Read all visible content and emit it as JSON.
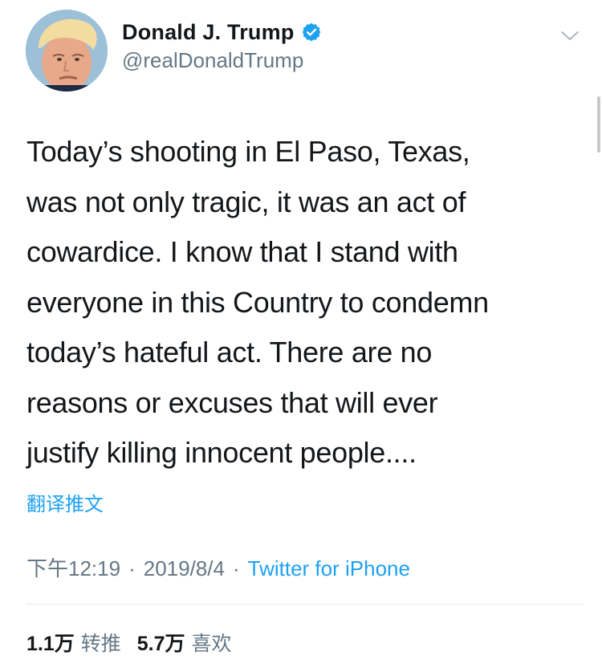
{
  "author": {
    "display_name": "Donald J. Trump",
    "handle": "@realDonaldTrump",
    "avatar_icon": "profile-photo",
    "verified_icon": "verified-badge-icon"
  },
  "menu_icon": "chevron-down-icon",
  "tweet": {
    "lines": [
      "Today’s shooting in El Paso, Texas,",
      "was not only tragic, it was an act of",
      "cowardice. I know that I stand with",
      "everyone in this Country to condemn",
      "today’s hateful act. There are no",
      "reasons or excuses that will ever",
      "justify killing innocent people...."
    ],
    "translate_label": "翻译推文"
  },
  "meta": {
    "time": "下午12:19",
    "separator": "·",
    "date": "2019/8/4",
    "source": "Twitter for iPhone"
  },
  "stats": {
    "retweets_count": "1.1万",
    "retweets_label": "转推",
    "likes_count": "5.7万",
    "likes_label": "喜欢"
  },
  "colors": {
    "accent": "#1da1f2",
    "secondary_text": "#657786",
    "primary_text": "#14171a",
    "divider": "#e1e8ed"
  }
}
